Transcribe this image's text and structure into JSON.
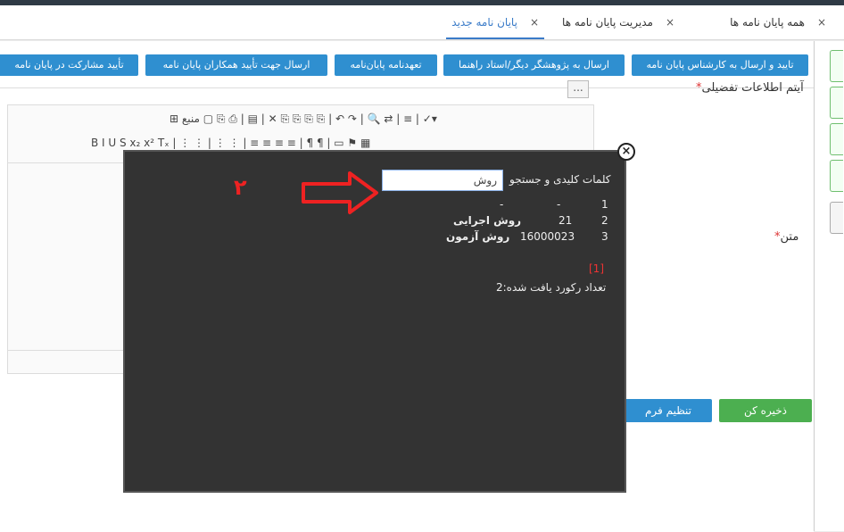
{
  "tabs": [
    {
      "label": "همه پایان نامه ها",
      "close": "×"
    },
    {
      "label": "مدیریت پایان نامه ها",
      "close": "×"
    },
    {
      "label": "پایان نامه جدید",
      "close": "×"
    }
  ],
  "actions": [
    "تایید و ارسال به کارشناس پایان نامه",
    "ارسال به پژوهشگر دیگر/استاد راهنما",
    "تعهدنامه پایان‌نامه",
    "ارسال جهت تأیید همکاران پایان نامه",
    "تأیید مشارکت در پایان نامه"
  ],
  "form": {
    "detail_label": "آیتم اطلاعات تفضیلی",
    "text_label": "متن",
    "required_mark": "*",
    "dots": "...",
    "source_label": "منبع"
  },
  "editor": {
    "row1": "⊞ منبع  ▢ ⎘ ⎙ | ▤ | ✕ ⎘ ⎘ ⎘ ⎘ | ↶ ↷ | 🔍 ⇄ | ≡ | ✓▾",
    "row2": "B I U S x₂ x² Tₓ | ⋮ ⋮ | ⋮ ⋮ | ≡ ≡ ≡ ≡ | ¶ ¶ | ▭ ⚑ ▦"
  },
  "buttons": {
    "save": "ذخیره کن",
    "form_settings": "تنظیم فرم"
  },
  "modal": {
    "close": "×",
    "search_label": "کلمات کلیدی و جستجو",
    "search_value": "روش",
    "step_number": "۲",
    "rows": [
      {
        "index": "1",
        "code": "-",
        "name": "-"
      },
      {
        "index": "2",
        "code": "21",
        "name": "روش اجرایی"
      },
      {
        "index": "3",
        "code": "16000023",
        "name": "روش آزمون"
      }
    ],
    "page_link": "[1]",
    "record_count": "تعداد رکورد یافت شده:2"
  },
  "colors": {
    "accent": "#2f8fd0",
    "save": "#4caf50",
    "modal_bg": "#333333",
    "annotation": "#e22222"
  }
}
